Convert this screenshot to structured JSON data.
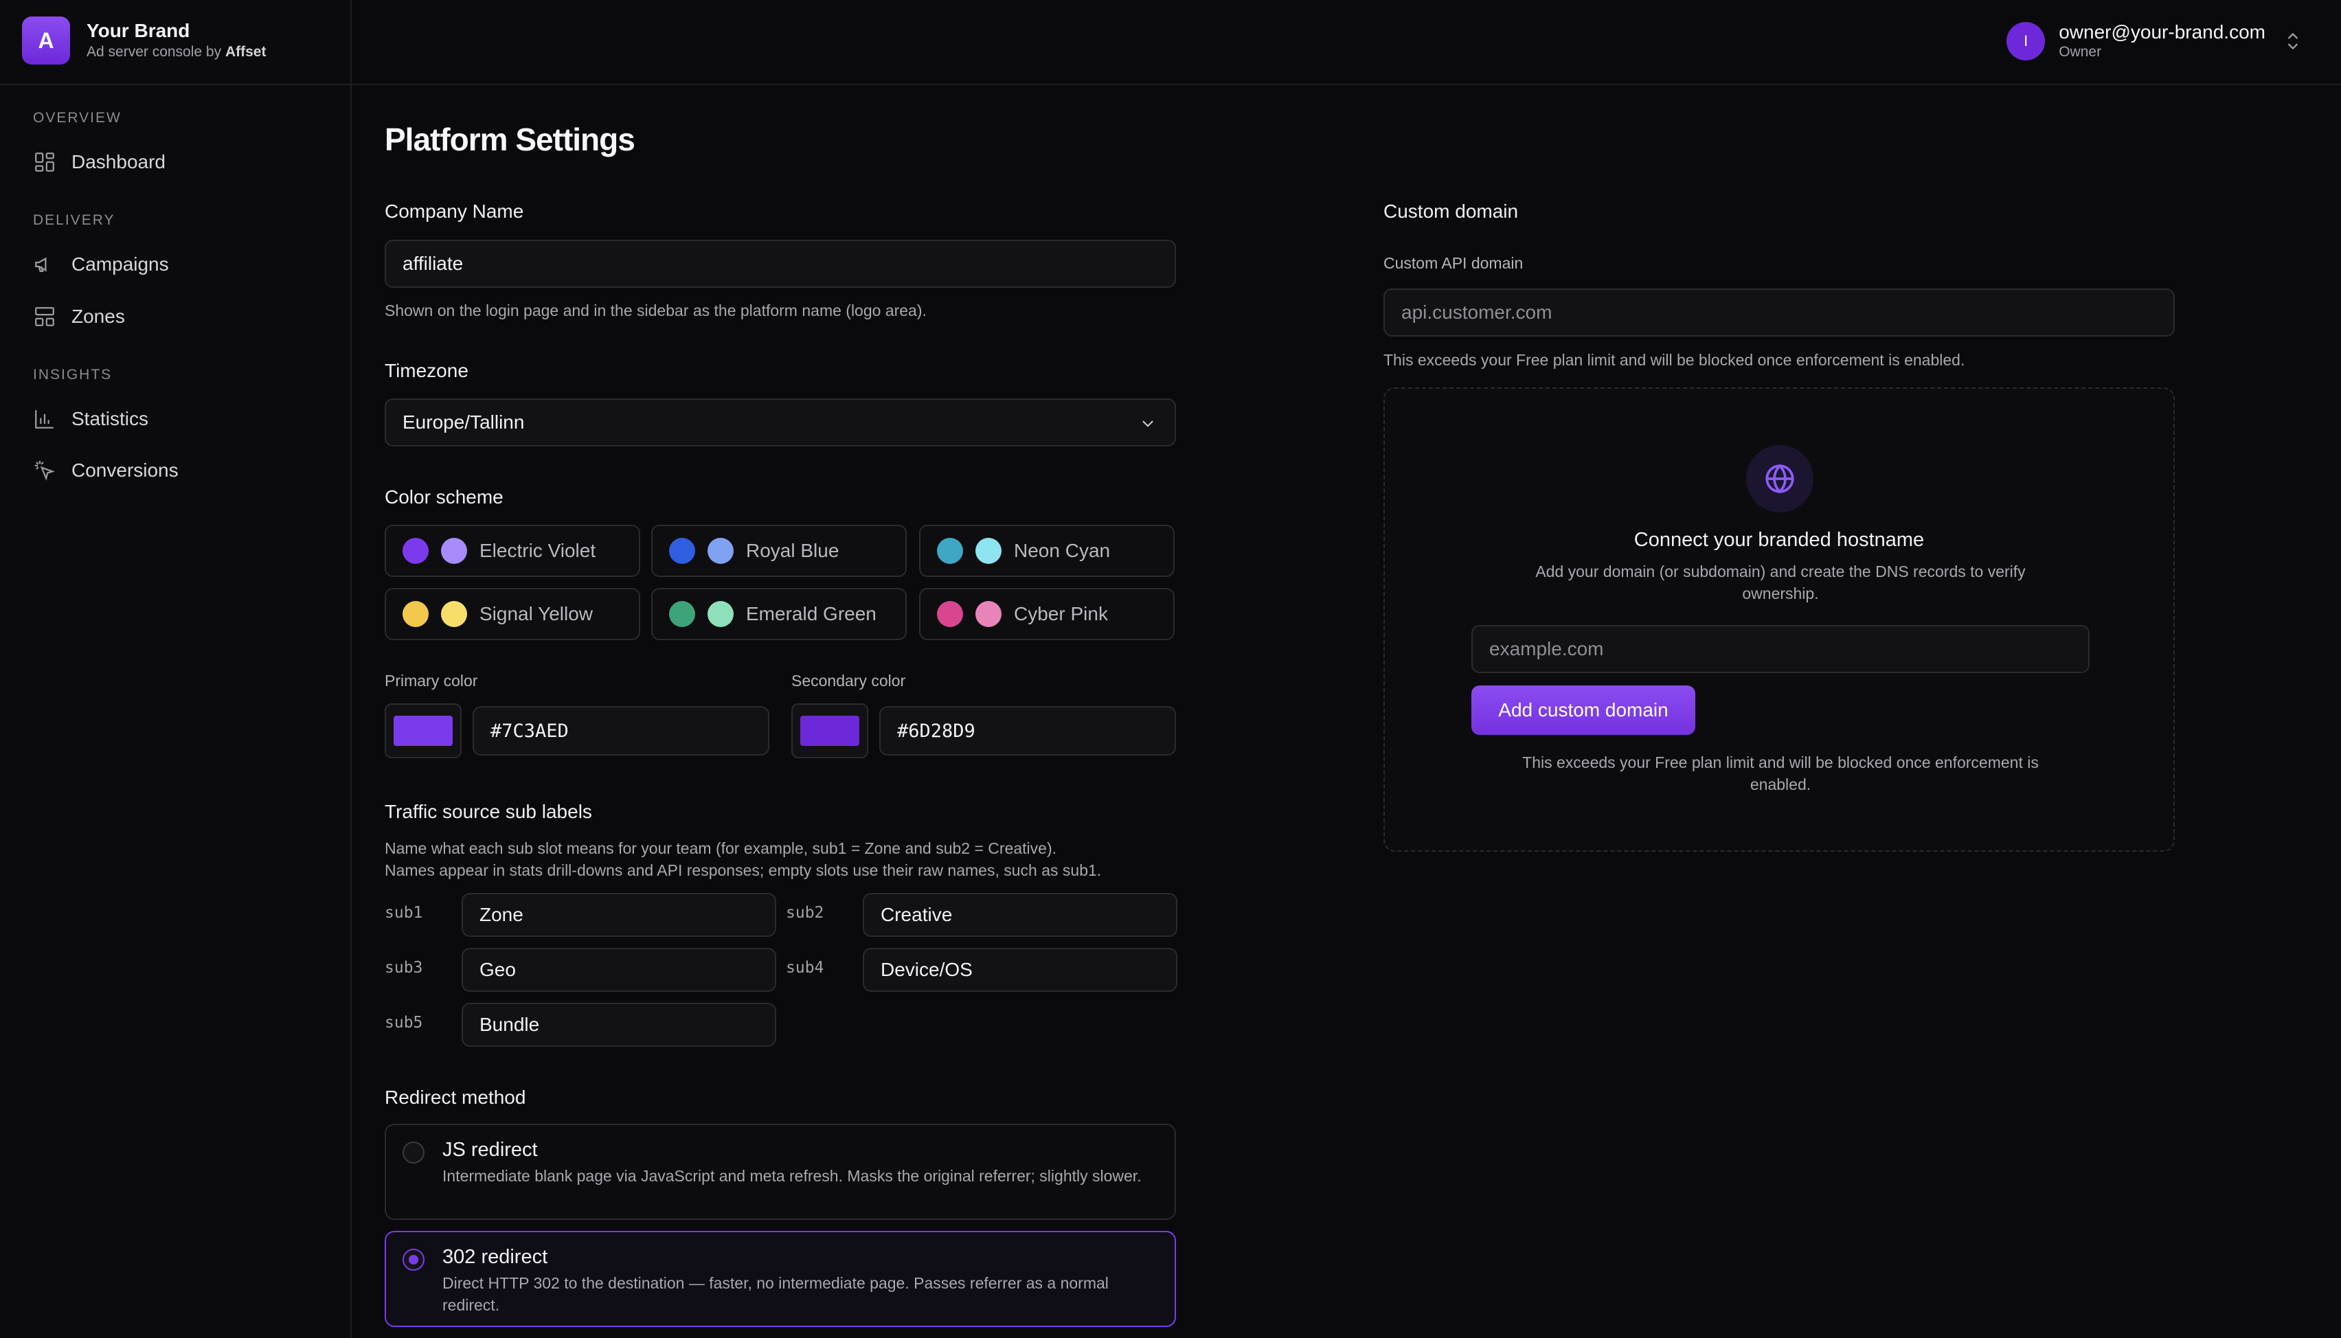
{
  "brand": {
    "logo_letter": "A",
    "name": "Your Brand",
    "sub_prefix": "Ad server console by",
    "sub_company": "Affset"
  },
  "user": {
    "initial": "I",
    "email": "owner@your-brand.com",
    "role": "Owner"
  },
  "sidebar": {
    "sections": [
      {
        "title": "OVERVIEW",
        "items": [
          {
            "label": "Dashboard",
            "icon": "dashboard-icon"
          }
        ]
      },
      {
        "title": "DELIVERY",
        "items": [
          {
            "label": "Campaigns",
            "icon": "megaphone-icon"
          },
          {
            "label": "Zones",
            "icon": "layout-icon"
          }
        ]
      },
      {
        "title": "INSIGHTS",
        "items": [
          {
            "label": "Statistics",
            "icon": "bar-chart-icon"
          },
          {
            "label": "Conversions",
            "icon": "cursor-click-icon"
          }
        ]
      }
    ]
  },
  "page": {
    "title": "Platform Settings"
  },
  "company": {
    "label": "Company Name",
    "value": "affiliate",
    "help": "Shown on the login page and in the sidebar as the platform name (logo area)."
  },
  "timezone": {
    "label": "Timezone",
    "value": "Europe/Tallinn"
  },
  "color_scheme": {
    "label": "Color scheme",
    "options": [
      {
        "name": "Electric Violet",
        "c1": "#7c3aed",
        "c2": "#a78bfa"
      },
      {
        "name": "Royal Blue",
        "c1": "#2f5ee0",
        "c2": "#7fa2f2"
      },
      {
        "name": "Neon Cyan",
        "c1": "#3fa6c4",
        "c2": "#8ee4f0"
      },
      {
        "name": "Signal Yellow",
        "c1": "#f2c94c",
        "c2": "#f7de6a"
      },
      {
        "name": "Emerald Green",
        "c1": "#3fa37a",
        "c2": "#8ee0bb"
      },
      {
        "name": "Cyber Pink",
        "c1": "#d9468f",
        "c2": "#e884b8"
      }
    ]
  },
  "colors": {
    "primary_label": "Primary color",
    "primary_value": "#7C3AED",
    "secondary_label": "Secondary color",
    "secondary_value": "#6D28D9"
  },
  "sub_labels": {
    "title": "Traffic source sub labels",
    "help_line1": "Name what each sub slot means for your team (for example, sub1 = Zone and sub2 = Creative).",
    "help_line2": "Names appear in stats drill-downs and API responses; empty slots use their raw names, such as sub1.",
    "slots": [
      {
        "key": "sub1",
        "value": "Zone"
      },
      {
        "key": "sub2",
        "value": "Creative"
      },
      {
        "key": "sub3",
        "value": "Geo"
      },
      {
        "key": "sub4",
        "value": "Device/OS"
      },
      {
        "key": "sub5",
        "value": "Bundle"
      }
    ]
  },
  "redirect": {
    "label": "Redirect method",
    "options": [
      {
        "title": "JS redirect",
        "desc": "Intermediate blank page via JavaScript and meta refresh. Masks the original referrer; slightly slower.",
        "selected": false
      },
      {
        "title": "302 redirect",
        "desc": "Direct HTTP 302 to the destination — faster, no intermediate page. Passes referrer as a normal redirect.",
        "selected": true
      }
    ]
  },
  "custom_domain": {
    "title": "Custom domain",
    "api_label": "Custom API domain",
    "api_placeholder": "api.customer.com",
    "limit_warning": "This exceeds your Free plan limit and will be blocked once enforcement is enabled.",
    "card_title": "Connect your branded hostname",
    "card_desc": "Add your domain (or subdomain) and create the DNS records to verify ownership.",
    "domain_placeholder": "example.com",
    "add_button": "Add custom domain",
    "card_warning": "This exceeds your Free plan limit and will be blocked once enforcement is enabled."
  }
}
